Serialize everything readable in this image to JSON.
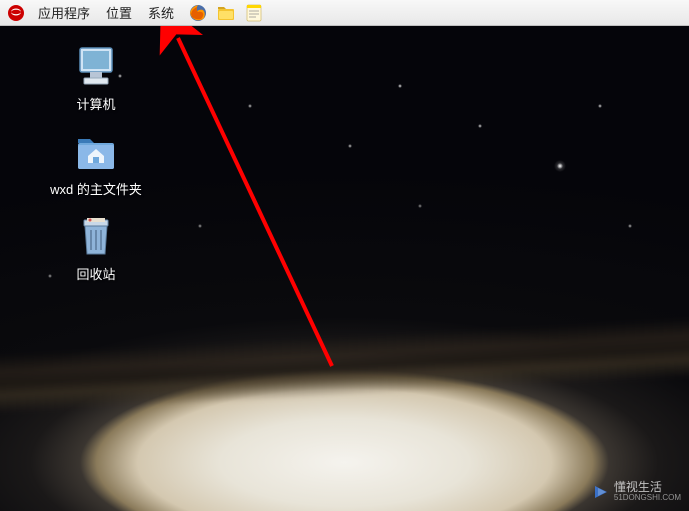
{
  "panel": {
    "menus": {
      "applications": "应用程序",
      "places": "位置",
      "system": "系统"
    }
  },
  "desktop": {
    "icons": {
      "computer": "计算机",
      "home": "wxd 的主文件夹",
      "trash": "回收站"
    }
  },
  "watermark": {
    "brand": "懂视生活",
    "url": "51DONGSHI.COM"
  }
}
